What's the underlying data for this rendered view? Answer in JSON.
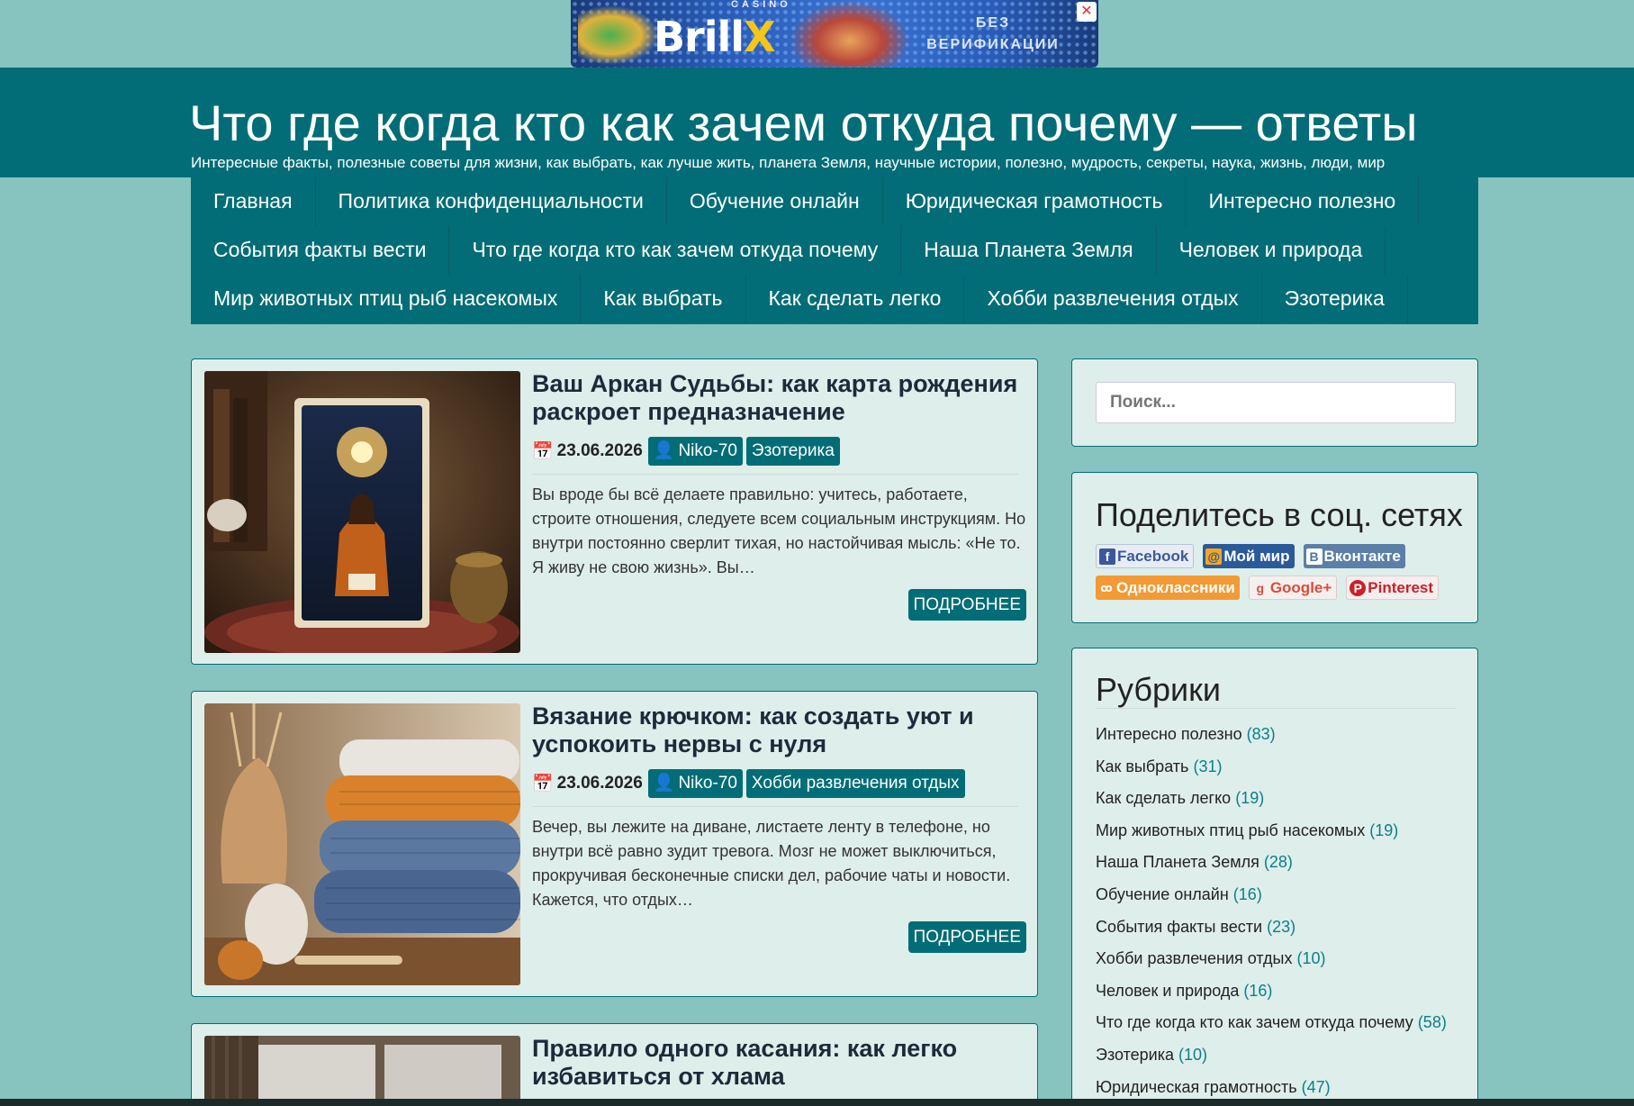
{
  "ad": {
    "casino_label": "CASINO",
    "logo_main": "Brill",
    "logo_x": "X",
    "tagline_1": "БЕЗ",
    "tagline_2": "ВЕРИФИКАЦИИ",
    "close": "✕"
  },
  "header": {
    "title": "Что где когда кто как зачем откуда почему — ответы",
    "description": "Интересные факты, полезные советы для жизни, как выбрать, как лучше жить, планета Земля, научные истории, полезно, мудрость, секреты, наука, жизнь, люди, мир"
  },
  "nav": {
    "rows": [
      [
        "Главная",
        "Политика конфиденциальности",
        "Обучение онлайн",
        "Юридическая грамотность",
        "Интересно полезно"
      ],
      [
        "События факты вести",
        "Что где когда кто как зачем откуда почему",
        "Наша Планета Земля",
        "Человек и природа"
      ],
      [
        "Мир животных птиц рыб насекомых",
        "Как выбрать",
        "Как сделать легко",
        "Хобби развлечения отдых",
        "Эзотерика"
      ]
    ]
  },
  "posts": [
    {
      "title": "Ваш Аркан Судьбы: как карта рождения раскроет предназначение",
      "date": "23.06.2026",
      "author": "Niko-70",
      "category": "Эзотерика",
      "excerpt": "Вы вроде бы всё делаете правильно: учитесь, работаете, строите отношения, следуете всем социальным инструкциям. Но внутри постоянно сверлит тихая, но настойчивая мысль: «Не то. Я живу не свою жизнь». Вы…",
      "more": "ПОДРОБНЕЕ"
    },
    {
      "title": "Вязание крючком: как создать уют и успокоить нервы с нуля",
      "date": "23.06.2026",
      "author": "Niko-70",
      "category": "Хобби развлечения отдых",
      "excerpt": "Вечер, вы лежите на диване, листаете ленту в телефоне, но внутри всё равно зудит тревога. Мозг не может выключиться, прокручивая бесконечные списки дел, рабочие чаты и новости. Кажется, что отдых…",
      "more": "ПОДРОБНЕЕ"
    },
    {
      "title": "Правило одного касания: как легко избавиться от хлама"
    }
  ],
  "sidebar": {
    "search_placeholder": "Поиск...",
    "share_title": "Поделитесь в соц. сетях",
    "share_buttons": [
      {
        "label": "Facebook",
        "icon": "f",
        "color": "#3b5998"
      },
      {
        "label": "Мой мир",
        "icon": "@",
        "color": "#f5a623"
      },
      {
        "label": "Вконтакте",
        "icon": "B",
        "color": "#4c75a3"
      },
      {
        "label": "Одноклассники",
        "icon": "ok",
        "color": "#f0902a"
      },
      {
        "label": "Google+",
        "icon": "g",
        "color": "#dd4b39"
      },
      {
        "label": "Pinterest",
        "icon": "P",
        "color": "#cb2027"
      }
    ],
    "categories_title": "Рубрики",
    "categories": [
      {
        "name": "Интересно полезно",
        "count": "(83)"
      },
      {
        "name": "Как выбрать",
        "count": "(31)"
      },
      {
        "name": "Как сделать легко",
        "count": "(19)"
      },
      {
        "name": "Мир животных птиц рыб насекомых",
        "count": "(19)"
      },
      {
        "name": "Наша Планета Земля",
        "count": "(28)"
      },
      {
        "name": "Обучение онлайн",
        "count": "(16)"
      },
      {
        "name": "События факты вести",
        "count": "(23)"
      },
      {
        "name": "Хобби развлечения отдых",
        "count": "(10)"
      },
      {
        "name": "Человек и природа",
        "count": "(16)"
      },
      {
        "name": "Что где когда кто как зачем откуда почему",
        "count": "(58)"
      },
      {
        "name": "Эзотерика",
        "count": "(10)"
      },
      {
        "name": "Юридическая грамотность",
        "count": "(47)"
      }
    ]
  }
}
